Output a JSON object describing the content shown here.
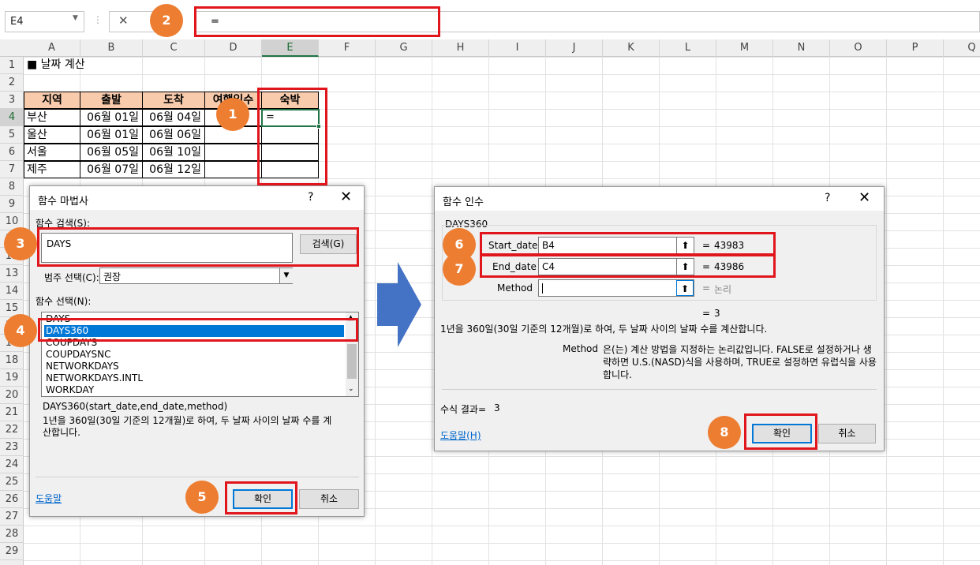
{
  "formula_bar": {
    "name_box": "E4",
    "cancel_icon": "✕",
    "formula": "="
  },
  "columns": [
    "A",
    "B",
    "C",
    "D",
    "E",
    "F",
    "G",
    "H",
    "I",
    "J",
    "K",
    "L",
    "M",
    "N",
    "O",
    "P",
    "Q"
  ],
  "rows": [
    "1",
    "2",
    "3",
    "4",
    "5",
    "6",
    "7",
    "8",
    "9",
    "10",
    "11",
    "12",
    "13",
    "14",
    "15",
    "16",
    "17",
    "18",
    "19",
    "20",
    "21",
    "22",
    "23",
    "24",
    "25",
    "26",
    "27",
    "28",
    "29"
  ],
  "sheet": {
    "title": "■ 날짜 계산",
    "headers": [
      "지역",
      "출발",
      "도착",
      "여행일수",
      "숙박"
    ],
    "table": [
      [
        "부산",
        "06월 01일",
        "06월 04일"
      ],
      [
        "울산",
        "06월 01일",
        "06월 06일"
      ],
      [
        "서울",
        "06월 05일",
        "06월 10일"
      ],
      [
        "제주",
        "06월 07일",
        "06월 12일"
      ]
    ],
    "active_cell_value": "="
  },
  "function_wizard": {
    "title": "함수 마법사",
    "help_q": "?",
    "close": "✕",
    "search_label": "함수 검색(S):",
    "search_value": "DAYS",
    "search_button": "검색(G)",
    "category_label": "범주 선택(C):",
    "category_value": "권장",
    "select_label": "함수 선택(N):",
    "functions": [
      "DAYS",
      "DAYS360",
      "COUPDAYS",
      "COUPDAYSNC",
      "NETWORKDAYS",
      "NETWORKDAYS.INTL",
      "WORKDAY"
    ],
    "selected_function": "DAYS360",
    "signature": "DAYS360(start_date,end_date,method)",
    "description": "1년을 360일(30일 기준의 12개월)로 하여, 두 날짜 사이의 날짜 수를 계산합니다.",
    "help_link": "도움말",
    "ok": "확인",
    "cancel": "취소"
  },
  "function_args": {
    "title": "함수 인수",
    "help_q": "?",
    "close": "✕",
    "function_name": "DAYS360",
    "args": [
      {
        "label": "Start_date",
        "value": "B4",
        "result": "43983"
      },
      {
        "label": "End_date",
        "value": "C4",
        "result": "43986"
      },
      {
        "label": "Method",
        "value": "",
        "result": "논리"
      }
    ],
    "eq": "=",
    "result_line": "3",
    "description": "1년을 360일(30일 기준의 12개월)로 하여, 두 날짜 사이의 날짜 수를 계산합니다.",
    "method_label": "Method",
    "method_desc": "은(는) 계산 방법을 지정하는 논리값입니다. FALSE로 설정하거나 생략하면 U.S.(NASD)식을 사용하며, TRUE로 설정하면 유럽식을 사용합니다.",
    "formula_result_label": "수식 결과=",
    "formula_result_value": "3",
    "help_link": "도움말(H)",
    "ok": "확인",
    "cancel": "취소"
  },
  "badges": [
    "1",
    "2",
    "3",
    "4",
    "5",
    "6",
    "7",
    "8"
  ],
  "colors": {
    "accent_red": "#e0161c",
    "badge_orange": "#ed7d31",
    "table_header": "#f8cbad",
    "excel_green": "#217346",
    "selection_blue": "#0078d7",
    "arrow_blue": "#4472c4"
  }
}
